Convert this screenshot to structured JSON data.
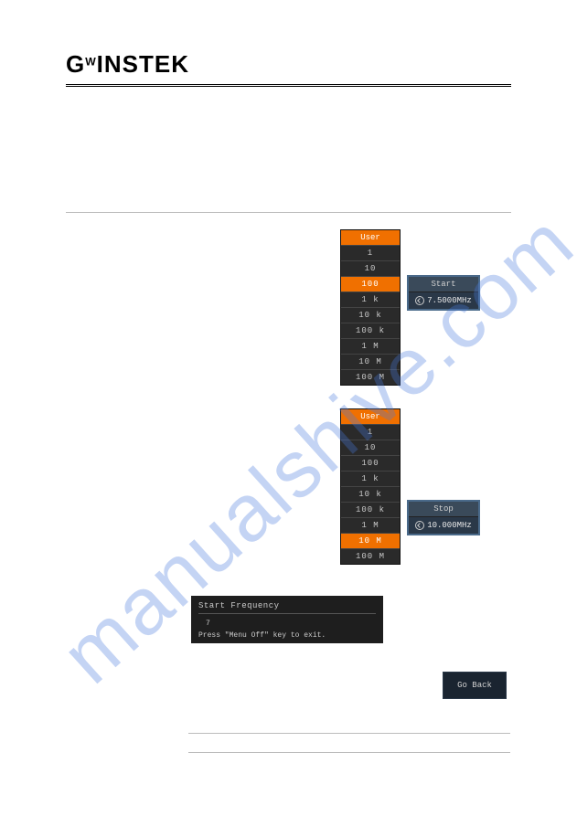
{
  "logo": "G°INSTEK",
  "watermark": "manualshive.com",
  "menu1": {
    "header": "User",
    "items": [
      "1",
      "10",
      "100",
      "1  k",
      "10  k",
      "100  k",
      "1  M",
      "10  M",
      "100  M"
    ],
    "selected_index": 2
  },
  "sidebox1": {
    "title": "Start",
    "value": "7.5000MHz"
  },
  "menu2": {
    "header": "User",
    "items": [
      "1",
      "10",
      "100",
      "1  k",
      "10  k",
      "100  k",
      "1  M",
      "10  M",
      "100  M"
    ],
    "selected_index": 7
  },
  "sidebox2": {
    "title": "Stop",
    "value": "10.000MHz"
  },
  "msgbox": {
    "title": "Start Frequency",
    "freq": "7",
    "note": "Press \"Menu Off\" key to exit."
  },
  "goback": "Go Back"
}
